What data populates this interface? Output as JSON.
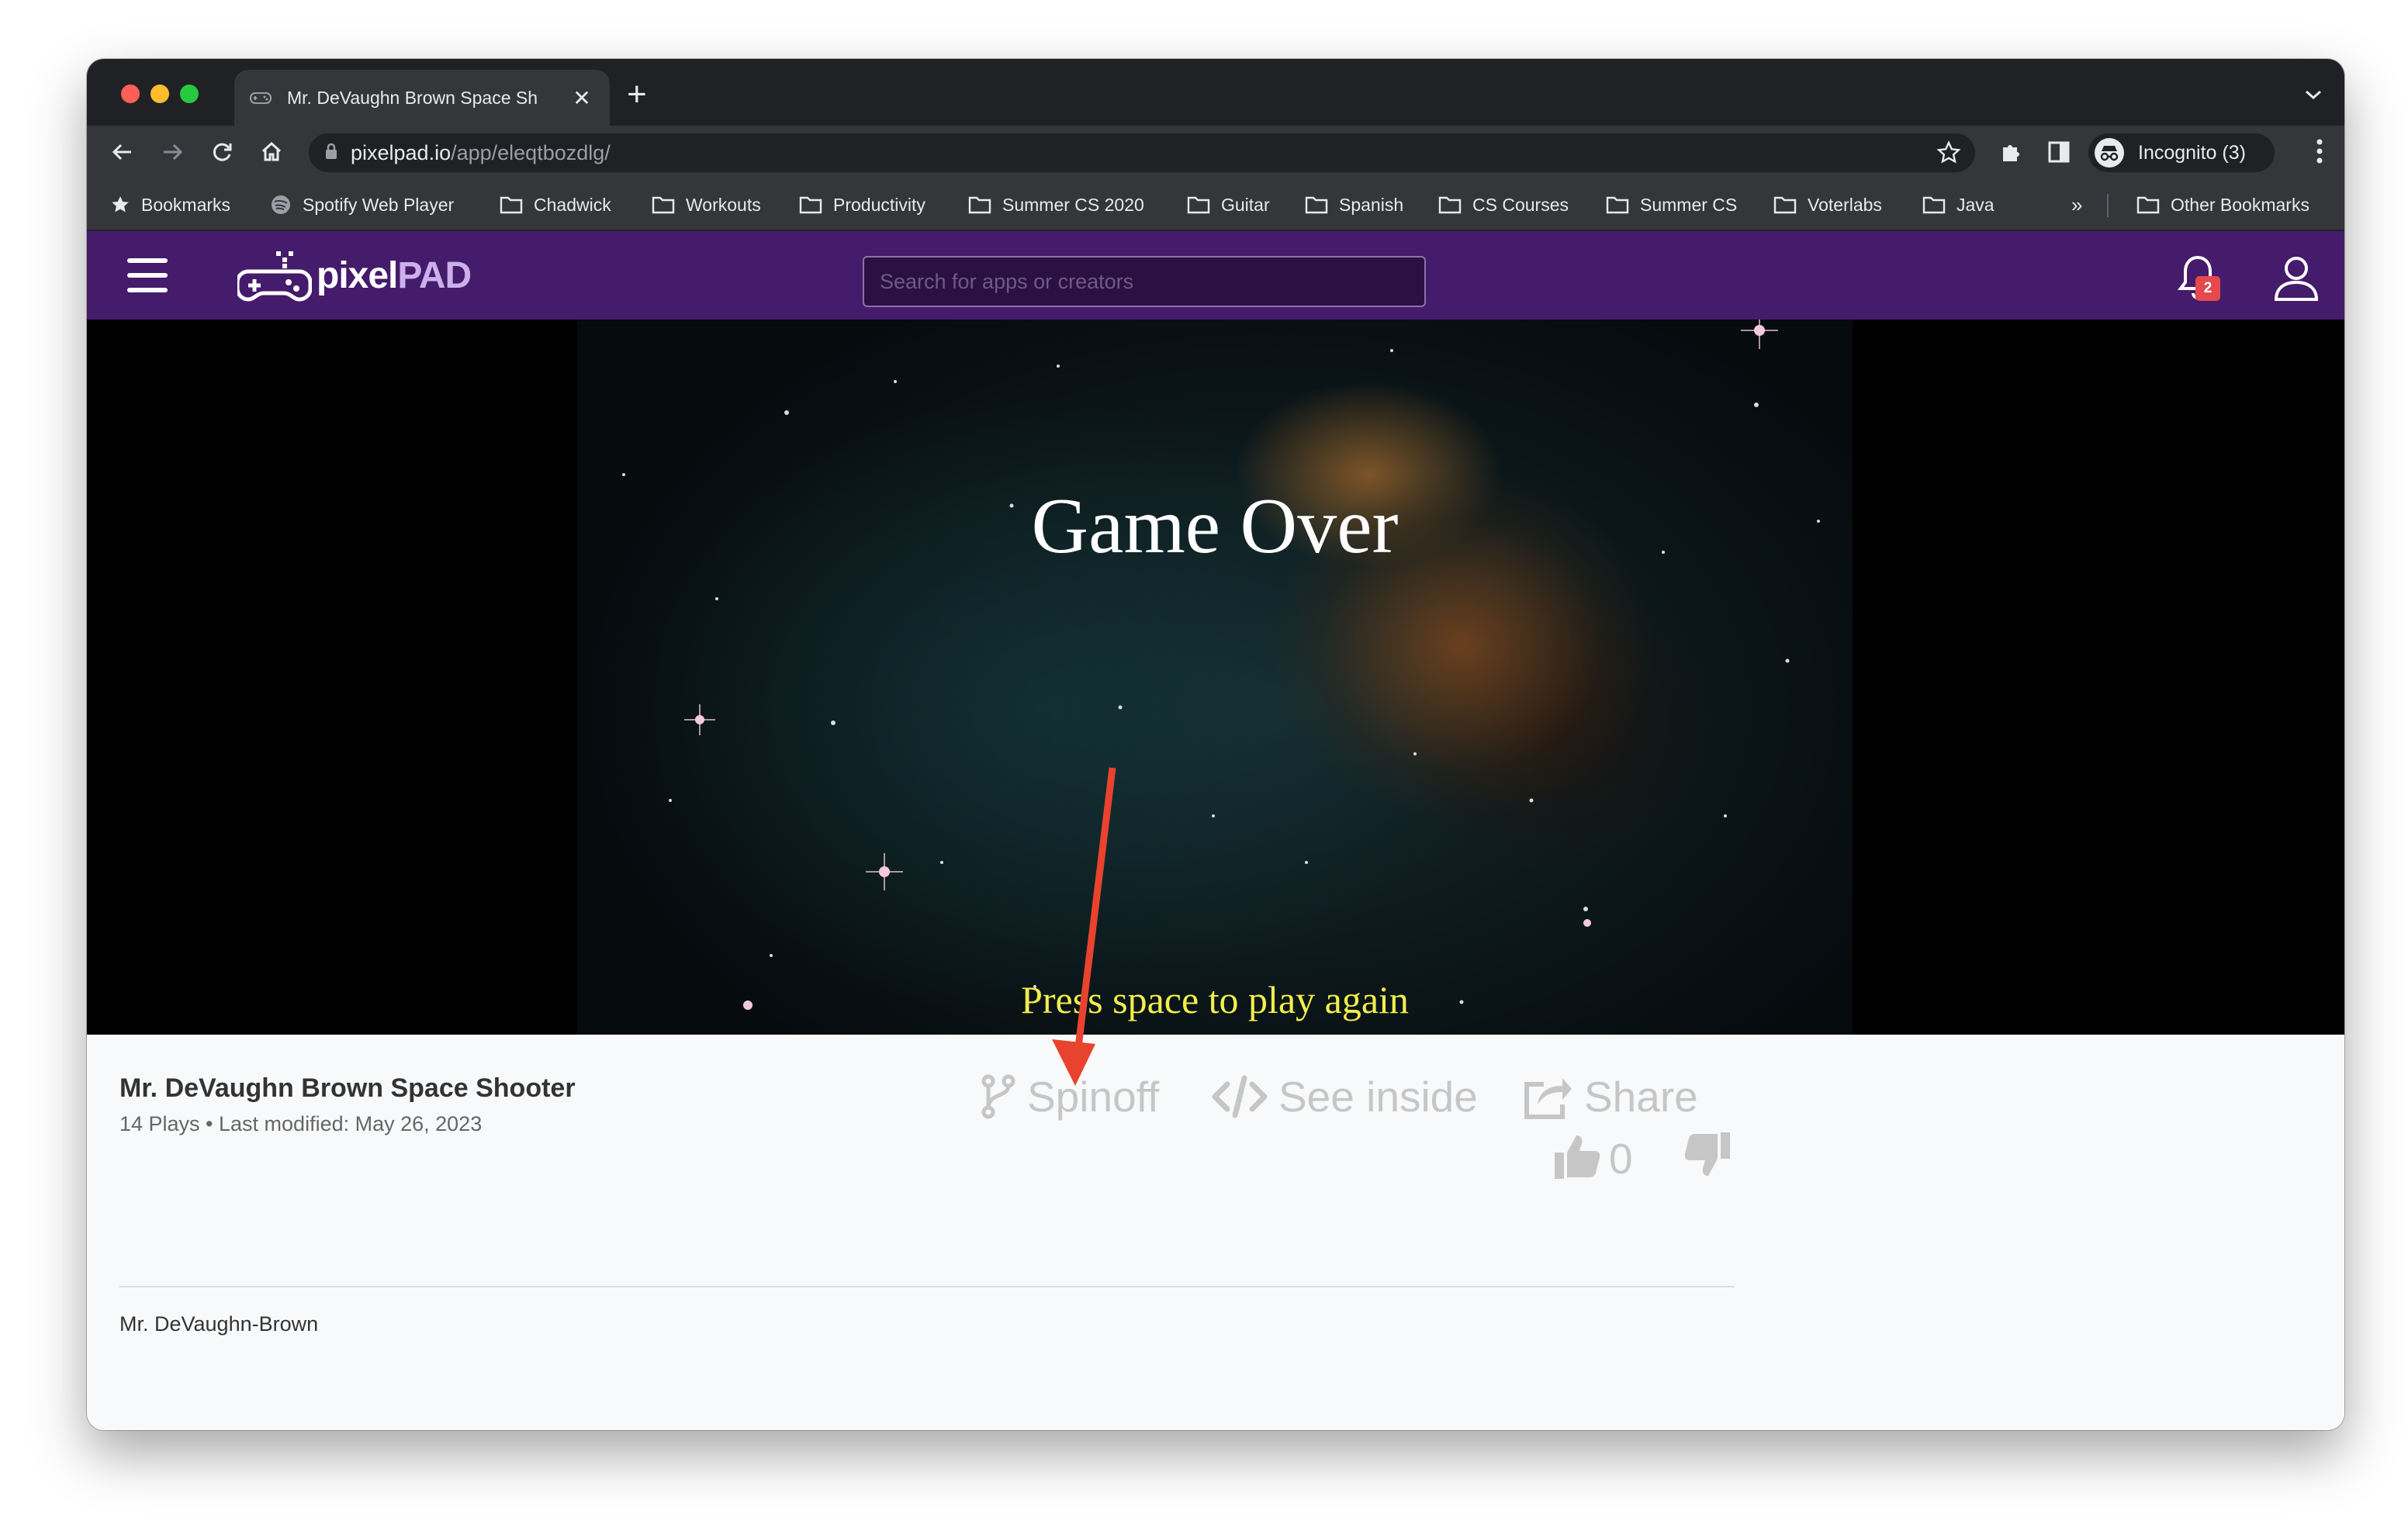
{
  "browser": {
    "tab_title": "Mr. DeVaughn Brown Space Sh",
    "new_tab_symbol": "+",
    "close_symbol": "✕",
    "url_host": "pixelpad.io",
    "url_path": "/app/eleqtbozdlg/",
    "incognito_label": "Incognito (3)",
    "bookmarks": [
      {
        "label": "Bookmarks",
        "icon": "star-icon"
      },
      {
        "label": "Spotify Web Player",
        "icon": "globe-icon"
      },
      {
        "label": "Chadwick",
        "icon": "folder-icon"
      },
      {
        "label": "Workouts",
        "icon": "folder-icon"
      },
      {
        "label": "Productivity",
        "icon": "folder-icon"
      },
      {
        "label": "Summer CS 2020",
        "icon": "folder-icon"
      },
      {
        "label": "Guitar",
        "icon": "folder-icon"
      },
      {
        "label": "Spanish",
        "icon": "folder-icon"
      },
      {
        "label": "CS Courses",
        "icon": "folder-icon"
      },
      {
        "label": "Summer CS",
        "icon": "folder-icon"
      },
      {
        "label": "Voterlabs",
        "icon": "folder-icon"
      },
      {
        "label": "Java",
        "icon": "folder-icon"
      }
    ],
    "bookmarks_overflow": "»",
    "other_bookmarks": "Other Bookmarks"
  },
  "app": {
    "logo_text_a": "pixel",
    "logo_text_b": "PAD",
    "search_placeholder": "Search for apps or creators",
    "notification_count": "2"
  },
  "game": {
    "title_text": "Game Over",
    "prompt_text": "Press space to play again"
  },
  "info": {
    "app_title": "Mr. DeVaughn Brown Space Shooter",
    "meta": "14 Plays • Last modified: May 26, 2023",
    "actions": {
      "spinoff": "Spinoff",
      "see_inside": "See inside",
      "share": "Share"
    },
    "likes": "0",
    "author": "Mr. DeVaughn-Brown"
  },
  "colors": {
    "app_header": "#451b6b",
    "action_grey": "#c6c6c6",
    "prompt_yellow": "#f2ee4b",
    "annotation_red": "#e8432f"
  }
}
